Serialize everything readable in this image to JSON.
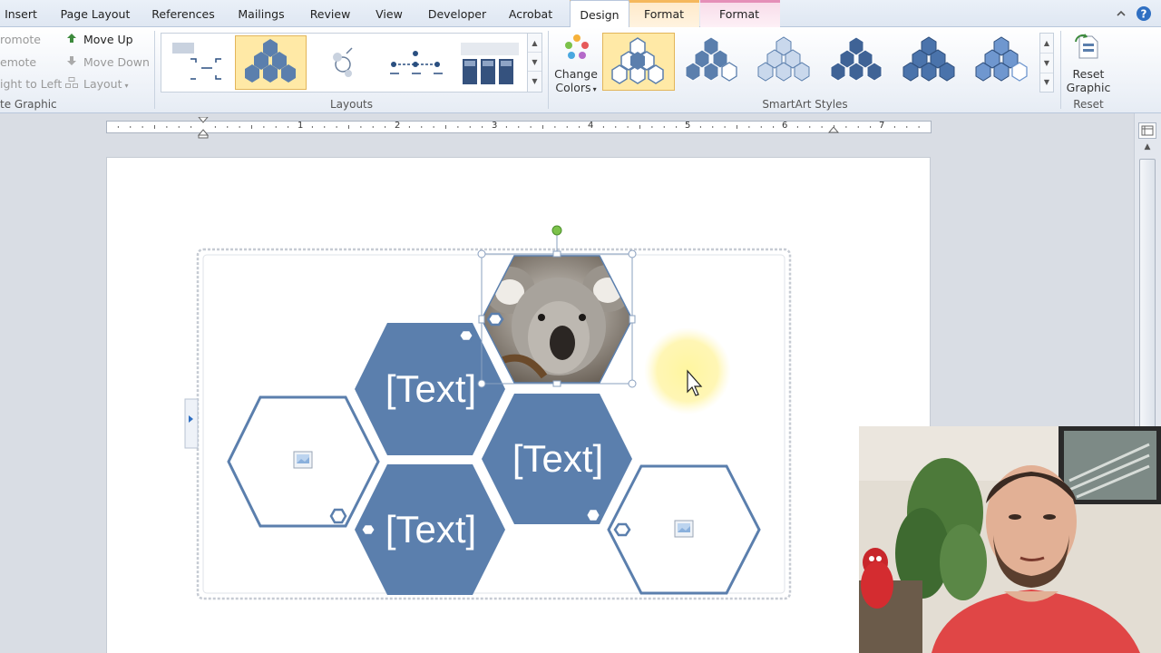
{
  "tabs": {
    "items": [
      {
        "label": "Insert"
      },
      {
        "label": "Page Layout"
      },
      {
        "label": "References"
      },
      {
        "label": "Mailings"
      },
      {
        "label": "Review"
      },
      {
        "label": "View"
      },
      {
        "label": "Developer"
      },
      {
        "label": "Acrobat"
      },
      {
        "label": "Design"
      },
      {
        "label": "Format"
      },
      {
        "label": "Format"
      }
    ],
    "active": "Design"
  },
  "ribbon": {
    "create_graphic": {
      "promote": "romote",
      "demote": "emote",
      "right_to_left": "ight to Left",
      "move_up": "Move Up",
      "move_down": "Move Down",
      "layout": "Layout",
      "group_label": "te Graphic"
    },
    "layouts": {
      "group_label": "Layouts"
    },
    "change_colors": {
      "line1": "Change",
      "line2": "Colors"
    },
    "smartart_styles": {
      "group_label": "SmartArt Styles"
    },
    "reset": {
      "line1": "Reset",
      "line2": "Graphic",
      "group_label": "Reset"
    }
  },
  "ruler": {
    "numbers": [
      "1",
      "2",
      "3",
      "4",
      "5",
      "6",
      "7"
    ]
  },
  "smartart": {
    "shape_texts": [
      "[Text]",
      "[Text]",
      "[Text]"
    ]
  },
  "colors": {
    "hex_fill": "#5b7fad",
    "hex_outline": "#5b7fad",
    "selection_handle": "#8aa0bf",
    "rotation_handle": "#7cc24a",
    "cursor_highlight": "#fff3a0",
    "design_tab_band": "#ffe0b3",
    "format_tab_band": "#f6d3e4",
    "ribbon_selected": "#ffe9a6"
  },
  "icons": [
    "move-up-icon",
    "move-down-icon",
    "layout-icon",
    "help-icon",
    "minimize-ribbon-icon",
    "image-placeholder-icon",
    "mouse-cursor-icon"
  ]
}
